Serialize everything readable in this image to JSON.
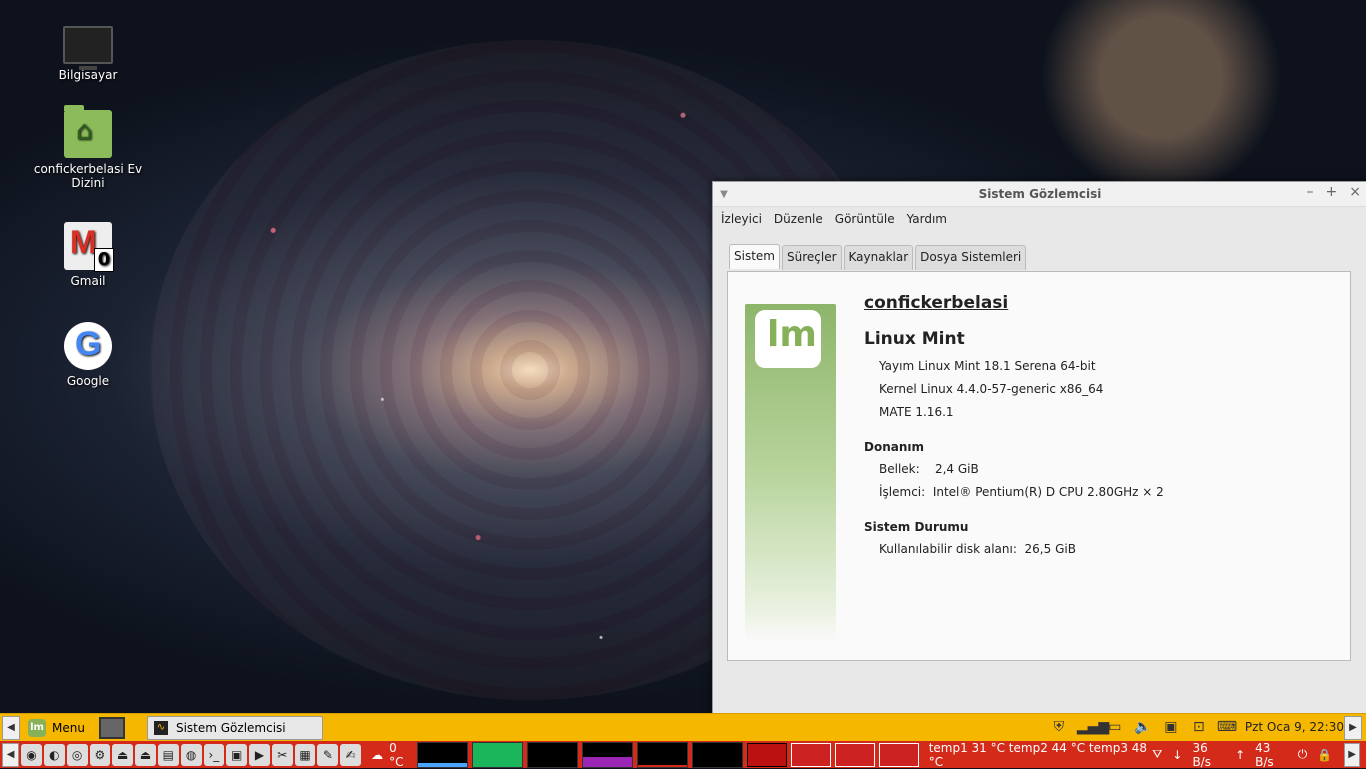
{
  "desktop": {
    "icons": [
      {
        "label": "Bilgisayar",
        "icon": "computer-icon"
      },
      {
        "label": "confickerbelasi Ev Dizini",
        "icon": "home-folder-icon"
      },
      {
        "label": "Gmail",
        "icon": "gmail-icon",
        "badge": "0"
      },
      {
        "label": "Google",
        "icon": "google-icon"
      }
    ]
  },
  "window": {
    "title": "Sistem Gözlemcisi",
    "menu": [
      "İzleyici",
      "Düzenle",
      "Görüntüle",
      "Yardım"
    ],
    "tabs": [
      "Sistem",
      "Süreçler",
      "Kaynaklar",
      "Dosya Sistemleri"
    ],
    "active_tab": "Sistem",
    "system": {
      "hostname": "confickerbelasi",
      "os_name": "Linux Mint",
      "release": "Yayım Linux Mint 18.1 Serena 64-bit",
      "kernel": "Kernel Linux 4.4.0-57-generic x86_64",
      "mate": "MATE 1.16.1",
      "hardware_title": "Donanım",
      "memory_label": "Bellek:",
      "memory_value": "2,4 GiB",
      "cpu_label": "İşlemci:",
      "cpu_value": "Intel® Pentium(R) D CPU 2.80GHz × 2",
      "status_title": "Sistem Durumu",
      "disk_label": "Kullanılabilir disk alanı:",
      "disk_value": "26,5 GiB"
    }
  },
  "top_panel": {
    "menu_label": "Menu",
    "task": "Sistem Gözlemcisi",
    "datetime": "Pzt Oca  9, 22:30"
  },
  "bottom_panel": {
    "weather": "0 °C",
    "temps": "temp1 31 °C temp2 44 °C temp3 48 °C",
    "net_down": "36 B/s",
    "net_up": "43 B/s"
  },
  "colors": {
    "top_panel": "#f6b700",
    "bottom_panel": "#d42a19",
    "mint_green": "#87b158"
  }
}
